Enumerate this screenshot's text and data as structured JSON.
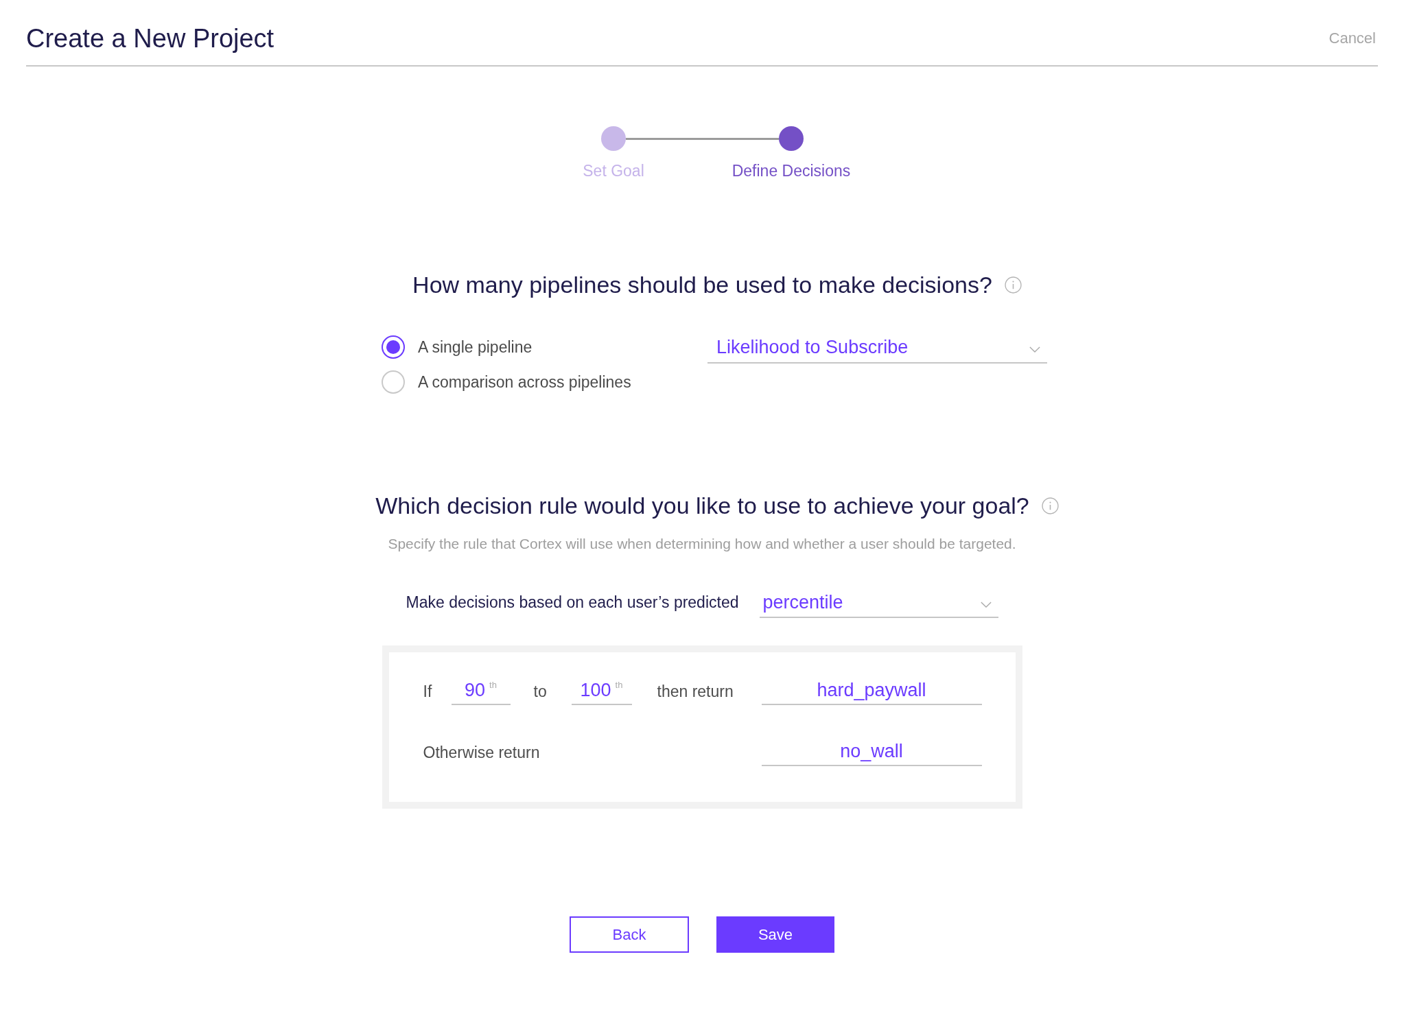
{
  "header": {
    "title": "Create a New Project",
    "cancel": "Cancel"
  },
  "steps": [
    {
      "label": "Set Goal",
      "selected": false
    },
    {
      "label": "Define Decisions",
      "selected": true
    }
  ],
  "pipelines": {
    "question": "How many pipelines should be used to make decisions?",
    "options": [
      {
        "label": "A single pipeline",
        "selected": true
      },
      {
        "label": "A comparison across pipelines",
        "selected": false
      }
    ],
    "pipeline_select": {
      "value": "Likelihood to Subscribe"
    }
  },
  "decision_rule": {
    "question": "Which decision rule would you like to use to achieve your goal?",
    "description": "Specify the rule that Cortex will use when determining how and whether a user should be targeted.",
    "basis_label": "Make decisions based on each user’s predicted",
    "basis_select": {
      "value": "percentile"
    },
    "rule": {
      "if_label": "If",
      "from": {
        "value": "90",
        "suffix": "th"
      },
      "to_label": "to",
      "to": {
        "value": "100",
        "suffix": "th"
      },
      "then_label": "then return",
      "then_value": "hard_paywall",
      "otherwise_label": "Otherwise return",
      "otherwise_value": "no_wall"
    }
  },
  "buttons": [
    {
      "label": "Back",
      "kind": "secondary"
    },
    {
      "label": "Save",
      "kind": "primary"
    }
  ]
}
